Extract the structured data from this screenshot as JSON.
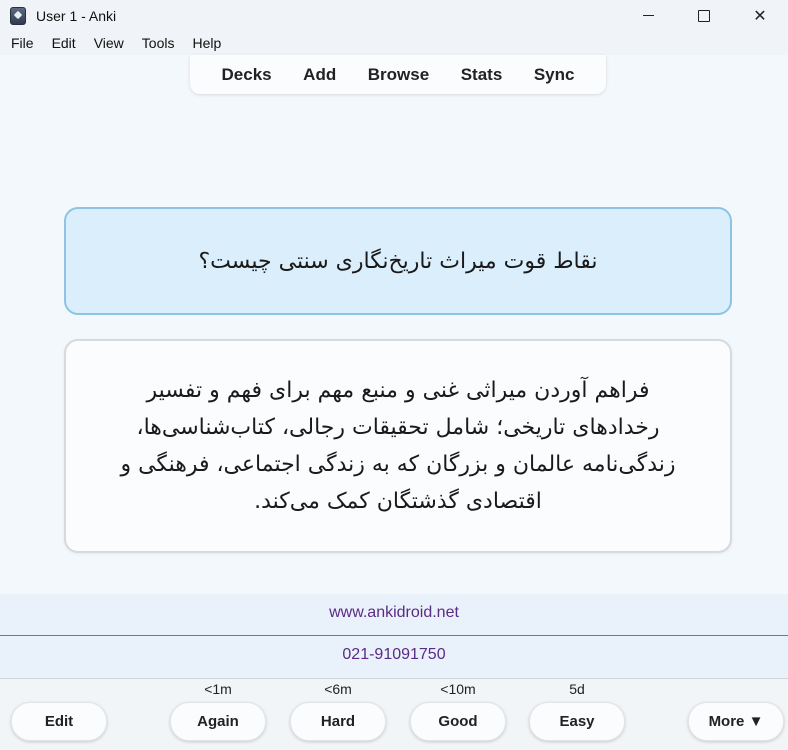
{
  "window": {
    "title": "User 1 - Anki",
    "close_glyph": "✕"
  },
  "menu": [
    "File",
    "Edit",
    "View",
    "Tools",
    "Help"
  ],
  "toolbar": [
    "Decks",
    "Add",
    "Browse",
    "Stats",
    "Sync"
  ],
  "card": {
    "question": "نقاط قوت میراث تاریخ‌نگاری سنتی چیست؟",
    "answer": "فراهم آوردن میراثی غنی و منبع مهم برای فهم و تفسیر رخدادهای تاریخی؛ شامل تحقیقات رجالی، کتاب‌شناسی‌ها، زندگی‌نامه عالمان و بزرگان که به زندگی اجتماعی، فرهنگی و اقتصادی گذشتگان کمک می‌کند."
  },
  "footer": {
    "website": "www.ankidroid.net",
    "phone": "021-91091750"
  },
  "answer_bar": {
    "edit_label": "Edit",
    "more_label": "More ▼",
    "buttons": [
      {
        "label": "Again",
        "interval": "<1m"
      },
      {
        "label": "Hard",
        "interval": "<6m"
      },
      {
        "label": "Good",
        "interval": "<10m"
      },
      {
        "label": "Easy",
        "interval": "5d"
      }
    ]
  },
  "colors": {
    "question_bg": "#dbeefb",
    "question_border": "#8cc5e3",
    "link_color": "#5b2a86"
  },
  "icons": {
    "app": "anki-icon",
    "minimize": "minimize-icon",
    "maximize": "maximize-icon",
    "close": "close-icon"
  }
}
